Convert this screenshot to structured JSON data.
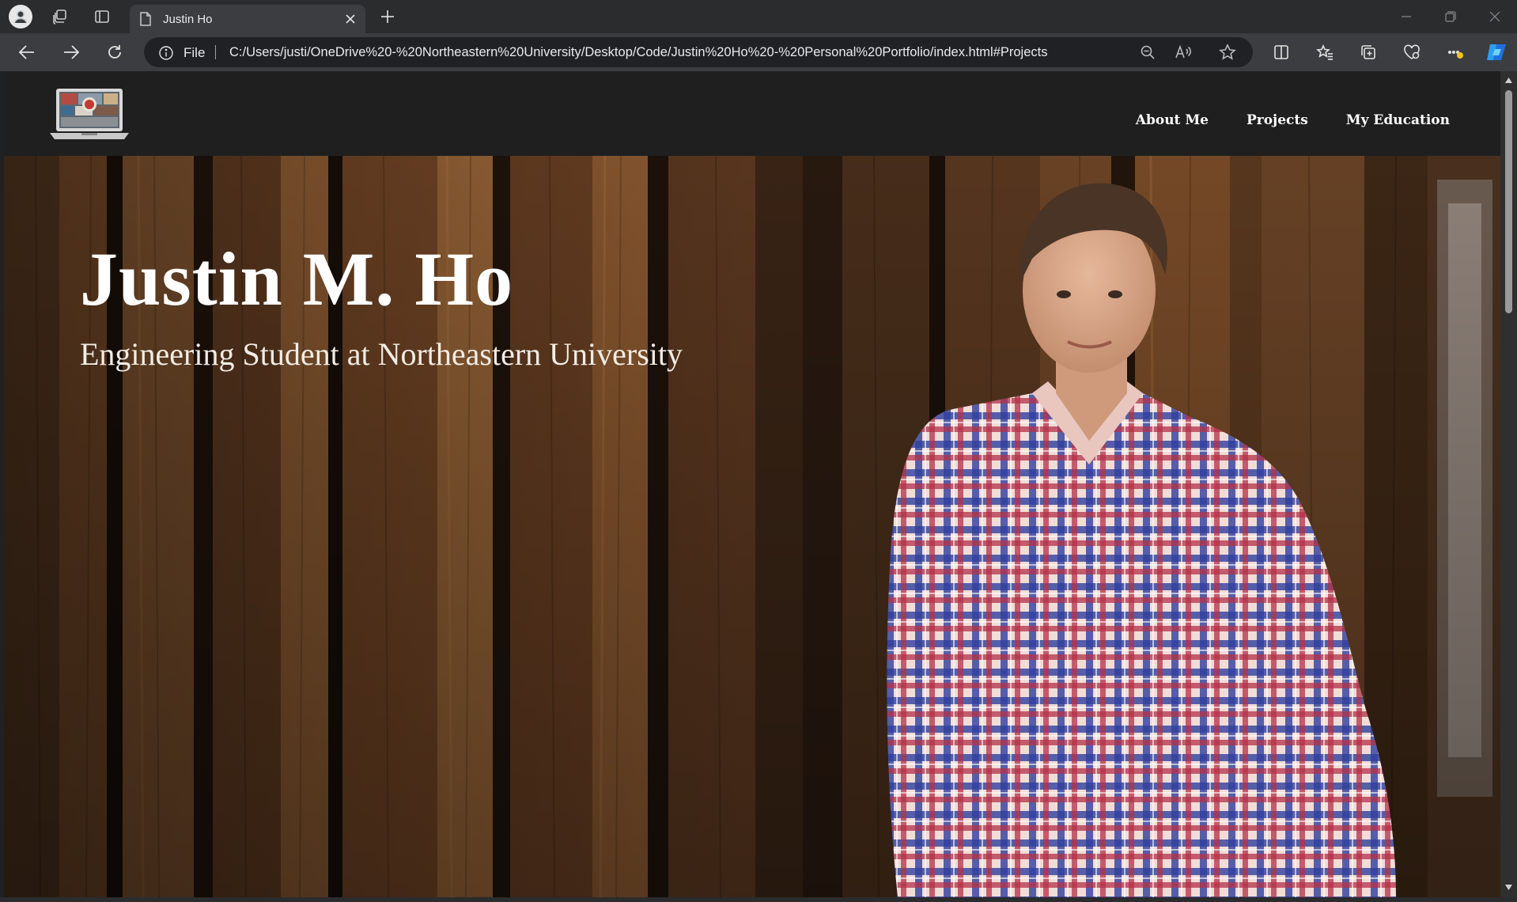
{
  "browser": {
    "tab": {
      "title": "Justin Ho",
      "favicon": "page-icon"
    },
    "address": {
      "scheme_label": "File",
      "url": "C:/Users/justi/OneDrive%20-%20Northeastern%20University/Desktop/Code/Justin%20Ho%20-%20Personal%20Portfolio/index.html#Projects"
    }
  },
  "site": {
    "nav": {
      "logo_icon": "laptop-logo-icon",
      "links": [
        {
          "label": "About Me"
        },
        {
          "label": "Projects"
        },
        {
          "label": "My Education"
        }
      ]
    },
    "hero": {
      "title": "Justin M. Ho",
      "subtitle": "Engineering Student at Northeastern University"
    }
  },
  "colors": {
    "chrome_tabbar": "#2b2c2e",
    "chrome_toolbar": "#3c3d40",
    "site_nav_bg": "#1f1f1f",
    "wood_dark": "#2a1a10",
    "wood_warm": "#8a5a33",
    "shirt_blue": "#2f3f9e",
    "shirt_red": "#b23048"
  }
}
